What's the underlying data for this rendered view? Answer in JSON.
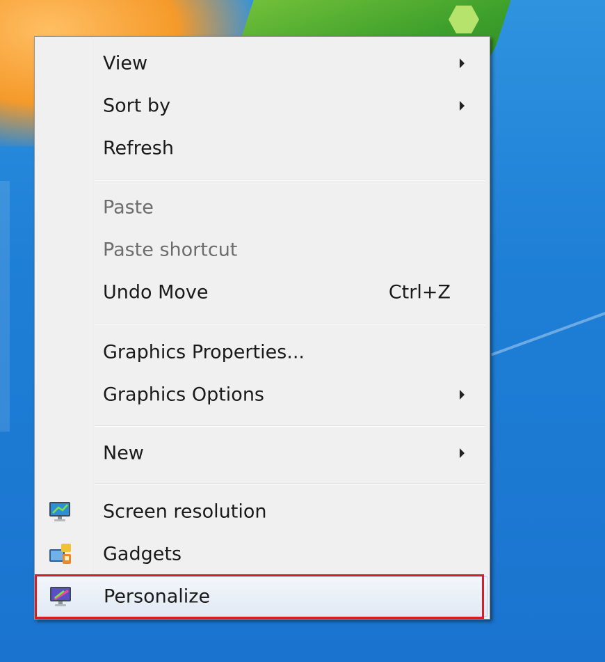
{
  "context_menu": {
    "items": [
      {
        "label": "View",
        "has_submenu": true
      },
      {
        "label": "Sort by",
        "has_submenu": true
      },
      {
        "label": "Refresh"
      },
      {
        "label": "Paste",
        "disabled": true
      },
      {
        "label": "Paste shortcut",
        "disabled": true
      },
      {
        "label": "Undo Move",
        "shortcut": "Ctrl+Z"
      },
      {
        "label": "Graphics Properties..."
      },
      {
        "label": "Graphics Options",
        "has_submenu": true
      },
      {
        "label": "New",
        "has_submenu": true
      },
      {
        "label": "Screen resolution",
        "icon": "screen-resolution-icon"
      },
      {
        "label": "Gadgets",
        "icon": "gadgets-icon"
      },
      {
        "label": "Personalize",
        "icon": "personalize-icon",
        "highlighted": true
      }
    ]
  },
  "colors": {
    "menu_background": "#f0f0f0",
    "highlight_outline": "#d12027",
    "desktop_blue": "#1e7fd6"
  }
}
